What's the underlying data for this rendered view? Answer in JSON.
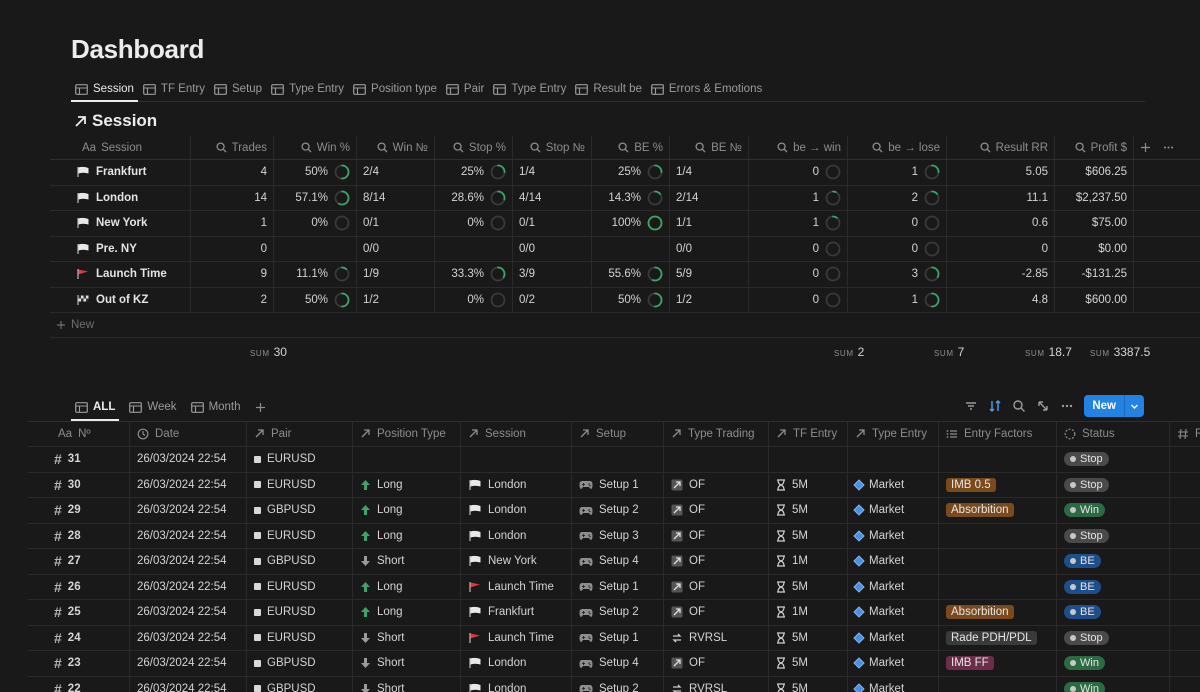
{
  "page": {
    "title": "Dashboard"
  },
  "top_tabs": [
    {
      "label": "Session",
      "active": true
    },
    {
      "label": "TF Entry"
    },
    {
      "label": "Setup"
    },
    {
      "label": "Type Entry"
    },
    {
      "label": "Position type"
    },
    {
      "label": "Pair"
    },
    {
      "label": "Type Entry"
    },
    {
      "label": "Result be"
    },
    {
      "label": "Errors & Emotions"
    }
  ],
  "session_section": {
    "title": "Session",
    "columns": [
      "Session",
      "Trades",
      "Win %",
      "Win №",
      "Stop %",
      "Stop №",
      "BE %",
      "BE №",
      "be → win",
      "be → lose",
      "Result RR",
      "Profit $"
    ],
    "column_prefixes": {
      "session": "Aa"
    },
    "rows": [
      {
        "flag": "white",
        "name": "Frankfurt",
        "trades": "4",
        "win_pct": "50%",
        "win_ring": 0.5,
        "win_no": "2/4",
        "stop_pct": "25%",
        "stop_ring": 0.25,
        "stop_no": "1/4",
        "be_pct": "25%",
        "be_ring": 0.25,
        "be_no": "1/4",
        "be_win": "0",
        "be_win_ring": 0,
        "be_lose": "1",
        "be_lose_ring": 0.25,
        "rr": "5.05",
        "profit": "$606.25"
      },
      {
        "flag": "white",
        "name": "London",
        "trades": "14",
        "win_pct": "57.1%",
        "win_ring": 0.571,
        "win_no": "8/14",
        "stop_pct": "28.6%",
        "stop_ring": 0.286,
        "stop_no": "4/14",
        "be_pct": "14.3%",
        "be_ring": 0.143,
        "be_no": "2/14",
        "be_win": "1",
        "be_win_ring": 0.07,
        "be_lose": "2",
        "be_lose_ring": 0.14,
        "rr": "11.1",
        "profit": "$2,237.50"
      },
      {
        "flag": "white",
        "name": "New York",
        "trades": "1",
        "win_pct": "0%",
        "win_ring": 0,
        "win_no": "0/1",
        "stop_pct": "0%",
        "stop_ring": 0,
        "stop_no": "0/1",
        "be_pct": "100%",
        "be_ring": 1,
        "be_no": "1/1",
        "be_win": "1",
        "be_win_ring": 0.1,
        "be_lose": "0",
        "be_lose_ring": 0,
        "rr": "0.6",
        "profit": "$75.00"
      },
      {
        "flag": "white",
        "name": "Pre. NY",
        "trades": "0",
        "win_pct": "",
        "win_ring": null,
        "win_no": "0/0",
        "stop_pct": "",
        "stop_ring": null,
        "stop_no": "0/0",
        "be_pct": "",
        "be_ring": null,
        "be_no": "0/0",
        "be_win": "0",
        "be_win_ring": 0,
        "be_lose": "0",
        "be_lose_ring": 0,
        "rr": "0",
        "profit": "$0.00"
      },
      {
        "flag": "red",
        "name": "Launch Time",
        "trades": "9",
        "win_pct": "11.1%",
        "win_ring": 0.111,
        "win_no": "1/9",
        "stop_pct": "33.3%",
        "stop_ring": 0.333,
        "stop_no": "3/9",
        "be_pct": "55.6%",
        "be_ring": 0.556,
        "be_no": "5/9",
        "be_win": "0",
        "be_win_ring": 0,
        "be_lose": "3",
        "be_lose_ring": 0.33,
        "rr": "-2.85",
        "profit": "-$131.25"
      },
      {
        "flag": "checker",
        "name": "Out of KZ",
        "trades": "2",
        "win_pct": "50%",
        "win_ring": 0.5,
        "win_no": "1/2",
        "stop_pct": "0%",
        "stop_ring": 0,
        "stop_no": "0/2",
        "be_pct": "50%",
        "be_ring": 0.5,
        "be_no": "1/2",
        "be_win": "0",
        "be_win_ring": 0,
        "be_lose": "1",
        "be_lose_ring": 0.5,
        "rr": "4.8",
        "profit": "$600.00"
      }
    ],
    "new_label": "New",
    "sum_label": "SUM",
    "sums": {
      "trades": "30",
      "be_win": "2",
      "be_lose": "7",
      "rr": "18.7",
      "profit": "3387.5"
    }
  },
  "bottom_tabs": [
    {
      "label": "ALL",
      "active": true
    },
    {
      "label": "Week"
    },
    {
      "label": "Month"
    }
  ],
  "toolbar": {
    "new_label": "New"
  },
  "trades": {
    "columns": [
      "Nº",
      "Date",
      "Pair",
      "Position Type",
      "Session",
      "Setup",
      "Type Trading",
      "TF Entry",
      "Type Entry",
      "Entry Factors",
      "Status",
      "R"
    ],
    "column_prefixes": {
      "no": "Aa"
    },
    "status_colors": {
      "Stop": "#4a4a4a",
      "Win": "#2b6a42",
      "BE": "#1f4f8a"
    },
    "factor_colors": {
      "IMB 0.5": "#7a4a1c",
      "Absorbition": "#7a4a1c",
      "Rade PDH/PDL": "#3a3a3a",
      "IMB FF": "#6a2d4a"
    },
    "rows": [
      {
        "no": "31",
        "date": "26/03/2024 22:54",
        "pair": "EURUSD",
        "position": "",
        "session": "",
        "session_flag": "",
        "setup": "",
        "type_trading": "",
        "tf": "",
        "type_entry": "",
        "factor": "",
        "status": "Stop"
      },
      {
        "no": "30",
        "date": "26/03/2024 22:54",
        "pair": "EURUSD",
        "position": "Long",
        "session": "London",
        "session_flag": "white",
        "setup": "Setup 1",
        "type_trading": "OF",
        "tf": "5M",
        "type_entry": "Market",
        "factor": "IMB 0.5",
        "status": "Stop"
      },
      {
        "no": "29",
        "date": "26/03/2024 22:54",
        "pair": "GBPUSD",
        "position": "Long",
        "session": "London",
        "session_flag": "white",
        "setup": "Setup 2",
        "type_trading": "OF",
        "tf": "5M",
        "type_entry": "Market",
        "factor": "Absorbition",
        "status": "Win"
      },
      {
        "no": "28",
        "date": "26/03/2024 22:54",
        "pair": "EURUSD",
        "position": "Long",
        "session": "London",
        "session_flag": "white",
        "setup": "Setup 3",
        "type_trading": "OF",
        "tf": "5M",
        "type_entry": "Market",
        "factor": "",
        "status": "Stop"
      },
      {
        "no": "27",
        "date": "26/03/2024 22:54",
        "pair": "GBPUSD",
        "position": "Short",
        "session": "New York",
        "session_flag": "white",
        "setup": "Setup 4",
        "type_trading": "OF",
        "tf": "1M",
        "type_entry": "Market",
        "factor": "",
        "status": "BE"
      },
      {
        "no": "26",
        "date": "26/03/2024 22:54",
        "pair": "EURUSD",
        "position": "Long",
        "session": "Launch Time",
        "session_flag": "red",
        "setup": "Setup 1",
        "type_trading": "OF",
        "tf": "5M",
        "type_entry": "Market",
        "factor": "",
        "status": "BE"
      },
      {
        "no": "25",
        "date": "26/03/2024 22:54",
        "pair": "EURUSD",
        "position": "Long",
        "session": "Frankfurt",
        "session_flag": "white",
        "setup": "Setup 2",
        "type_trading": "OF",
        "tf": "1M",
        "type_entry": "Market",
        "factor": "Absorbition",
        "status": "BE"
      },
      {
        "no": "24",
        "date": "26/03/2024 22:54",
        "pair": "EURUSD",
        "position": "Short",
        "session": "Launch Time",
        "session_flag": "red",
        "setup": "Setup 1",
        "type_trading": "RVRSL",
        "tf": "5M",
        "type_entry": "Market",
        "factor": "Rade PDH/PDL",
        "status": "Stop"
      },
      {
        "no": "23",
        "date": "26/03/2024 22:54",
        "pair": "GBPUSD",
        "position": "Short",
        "session": "London",
        "session_flag": "white",
        "setup": "Setup 4",
        "type_trading": "OF",
        "tf": "5M",
        "type_entry": "Market",
        "factor": "IMB FF",
        "status": "Win"
      },
      {
        "no": "22",
        "date": "26/03/2024 22:54",
        "pair": "GBPUSD",
        "position": "Short",
        "session": "London",
        "session_flag": "white",
        "setup": "Setup 2",
        "type_trading": "RVRSL",
        "tf": "5M",
        "type_entry": "Market",
        "factor": "",
        "status": "Win"
      }
    ]
  },
  "colors": {
    "background": "#191919",
    "accent": "#2383e2",
    "ring_fill": "#3ea36a",
    "long_arrow": "#3ea36a",
    "short_arrow": "#9b9b9b",
    "red_flag": "#d93a3a"
  }
}
